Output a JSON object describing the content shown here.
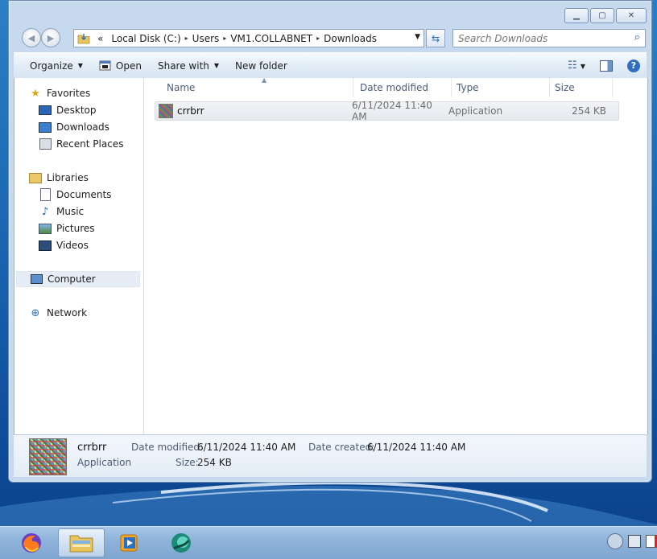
{
  "window": {
    "caption_buttons": [
      "minimize-icon",
      "maximize-icon",
      "close-icon"
    ]
  },
  "address_bar": {
    "overflow": "«",
    "segments": [
      "Local Disk (C:)",
      "Users",
      "VM1.COLLABNET",
      "Downloads"
    ],
    "separator": "▸"
  },
  "search": {
    "placeholder": "Search Downloads"
  },
  "toolbar": {
    "organize": "Organize",
    "open": "Open",
    "share_with": "Share with",
    "new_folder": "New folder"
  },
  "nav": {
    "favorites": "Favorites",
    "desktop": "Desktop",
    "downloads": "Downloads",
    "recent_places": "Recent Places",
    "libraries": "Libraries",
    "documents": "Documents",
    "music": "Music",
    "pictures": "Pictures",
    "videos": "Videos",
    "computer": "Computer",
    "network": "Network"
  },
  "columns": {
    "name": "Name",
    "date_modified": "Date modified",
    "type": "Type",
    "size": "Size"
  },
  "files": [
    {
      "name": "crrbrr",
      "date_modified": "6/11/2024 11:40 AM",
      "type": "Application",
      "size": "254 KB"
    }
  ],
  "details": {
    "name": "crrbrr",
    "type": "Application",
    "date_modified_label": "Date modified:",
    "date_modified": "6/11/2024 11:40 AM",
    "date_created_label": "Date created:",
    "date_created": "6/11/2024 11:40 AM",
    "size_label": "Size:",
    "size": "254 KB"
  },
  "taskbar": {
    "apps": [
      "firefox-icon",
      "explorer-icon",
      "media-player-icon",
      "app-icon"
    ]
  },
  "colors": {
    "desktop": "#1c67b3",
    "chrome": "#c7d9ee",
    "selection": "#e6edf6"
  }
}
